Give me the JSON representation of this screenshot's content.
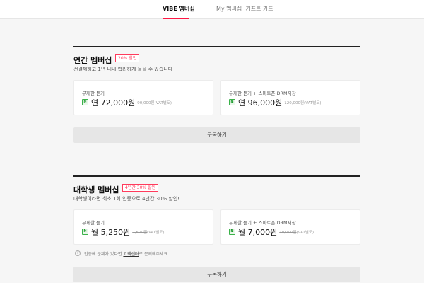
{
  "tabs": [
    {
      "label": "VIBE 멤버십",
      "active": true
    },
    {
      "label": "My 멤버십",
      "active": false
    },
    {
      "label": "기프트 카드",
      "active": false
    }
  ],
  "annual": {
    "title": "연간 멤버십",
    "badge": "20% 할인",
    "description": "선결제하고 1년 내내 합리하게 들을 수 있습니다",
    "plans": [
      {
        "name": "무제한 듣기",
        "price": "연 72,000원",
        "original": "90,000원",
        "vat": "(VAT별도)"
      },
      {
        "name": "무제한 듣기 + 스마트폰 DRM저장",
        "price": "연 96,000원",
        "original": "120,000원",
        "vat": "(VAT별도)"
      }
    ],
    "subscribe_label": "구독하기"
  },
  "student": {
    "title": "대학생 멤버십",
    "badge": "4년간 30% 할인",
    "description": "대학생이라면 최초 1회 인증으로 4년간 30% 할인!",
    "plans": [
      {
        "name": "무제한 듣기",
        "price": "월 5,250원",
        "original": "7,500원",
        "vat": "(VAT별도)"
      },
      {
        "name": "무제한 듣기 + 스마트폰 DRM저장",
        "price": "월 7,000원",
        "original": "10,000원",
        "vat": "(VAT별도)"
      }
    ],
    "notice_prefix": "인증에 문제가 있다면",
    "notice_link": "고객센터",
    "notice_suffix": "로 문의해주세요.",
    "subscribe_label": "구독하기"
  },
  "icons": {
    "naver": "N",
    "info": "i"
  },
  "colors": {
    "accent": "#ff1744",
    "badge": "#ff3b5c",
    "naver_green": "#3bb24a"
  }
}
